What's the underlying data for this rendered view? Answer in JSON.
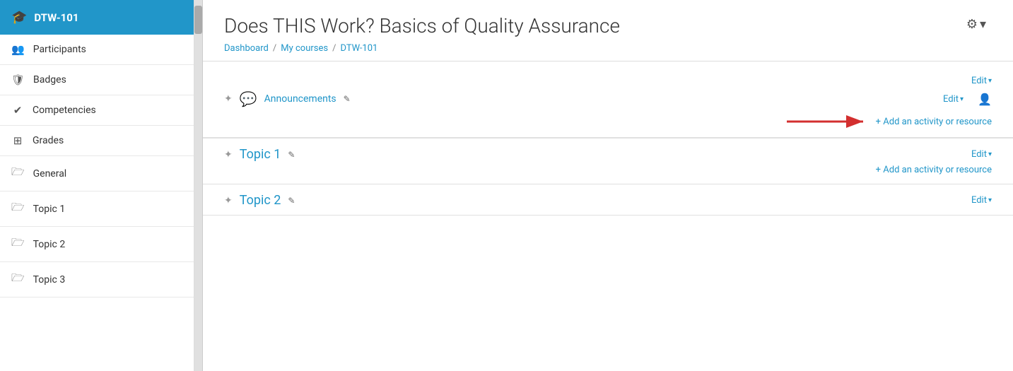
{
  "sidebar": {
    "header": {
      "title": "DTW-101",
      "icon": "🎓"
    },
    "items": [
      {
        "id": "participants",
        "label": "Participants",
        "icon": "👥"
      },
      {
        "id": "badges",
        "label": "Badges",
        "icon": "🛡"
      },
      {
        "id": "competencies",
        "label": "Competencies",
        "icon": "✓"
      },
      {
        "id": "grades",
        "label": "Grades",
        "icon": "⊞"
      },
      {
        "id": "general",
        "label": "General",
        "icon": "🗁"
      },
      {
        "id": "topic1",
        "label": "Topic 1",
        "icon": "🗁"
      },
      {
        "id": "topic2",
        "label": "Topic 2",
        "icon": "🗁"
      },
      {
        "id": "topic3",
        "label": "Topic 3",
        "icon": "🗁"
      }
    ]
  },
  "course": {
    "title": "Does THIS Work? Basics of Quality Assurance",
    "gear_label": "⚙",
    "breadcrumb": {
      "dashboard": "Dashboard",
      "separator1": "/",
      "mycourses": "My courses",
      "separator2": "/",
      "course": "DTW-101"
    }
  },
  "sections": {
    "general": {
      "edit_label": "Edit",
      "edit_dropdown": "▾",
      "activity": {
        "label": "Announcements",
        "edit_label": "Edit",
        "edit_dropdown": "▾"
      },
      "add_activity": "+ Add an activity or resource"
    },
    "topic1": {
      "title": "Topic 1",
      "edit_label": "Edit",
      "edit_dropdown": "▾",
      "add_activity": "+ Add an activity or resource"
    },
    "topic2": {
      "title": "Topic 2",
      "edit_label": "Edit",
      "edit_dropdown": "▾"
    }
  },
  "icons": {
    "drag": "⠿",
    "pencil": "✎",
    "plus": "+",
    "chevron_down": "▾",
    "user": "👤",
    "arrow_right": "→"
  }
}
